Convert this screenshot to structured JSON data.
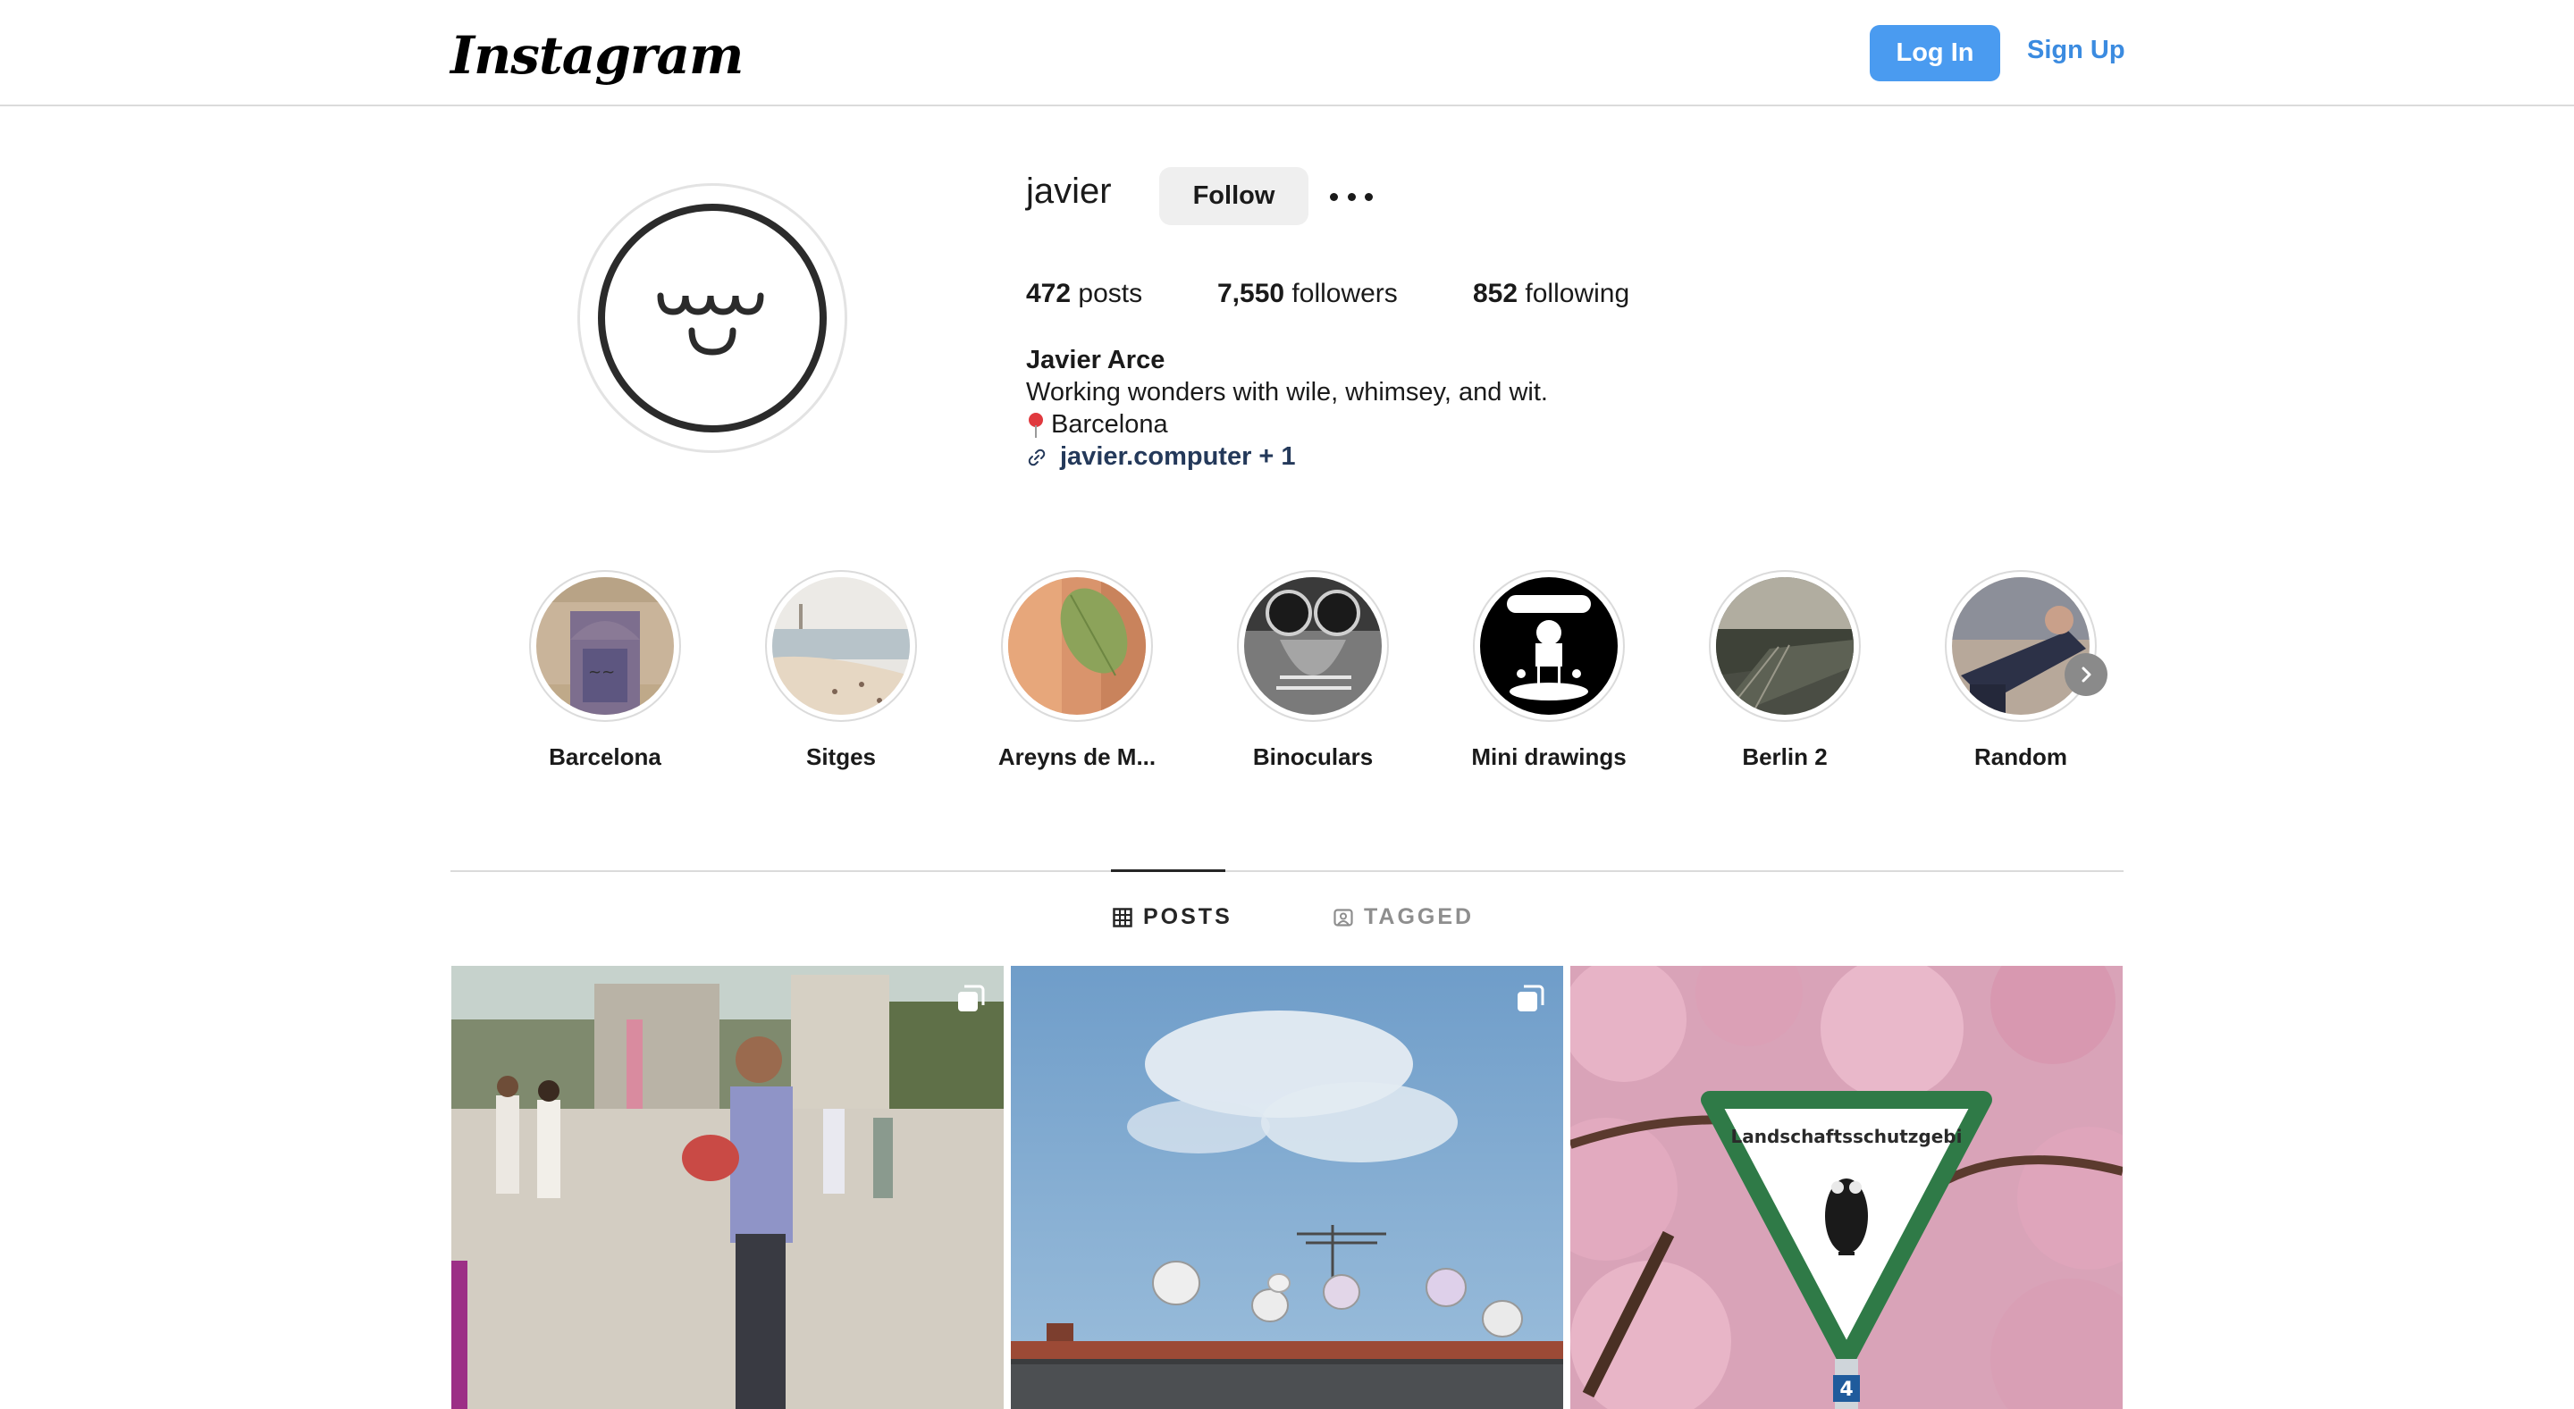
{
  "nav": {
    "logo_text": "Instagram",
    "login_label": "Log In",
    "signup_label": "Sign Up",
    "accent_color": "#4a9bf0"
  },
  "profile": {
    "username": "javier",
    "follow_label": "Follow",
    "avatar_icon": "smiley-face-icon",
    "stats": [
      {
        "count": "472",
        "label": "posts"
      },
      {
        "count": "7,550",
        "label": "followers"
      },
      {
        "count": "852",
        "label": "following"
      }
    ],
    "bio": {
      "name": "Javier Arce",
      "tagline": "Working wonders with wile, whimsey, and wit.",
      "location": "Barcelona",
      "link": "javier.computer + 1"
    }
  },
  "highlights": [
    {
      "label": "Barcelona"
    },
    {
      "label": "Sitges"
    },
    {
      "label": "Areyns de M..."
    },
    {
      "label": "Binoculars"
    },
    {
      "label": "Mini drawings"
    },
    {
      "label": "Berlin 2"
    },
    {
      "label": "Random"
    }
  ],
  "tabs": [
    {
      "label": "POSTS",
      "active": true
    },
    {
      "label": "TAGGED",
      "active": false
    }
  ],
  "posts": [
    {
      "multi": true
    },
    {
      "multi": true
    },
    {
      "multi": false,
      "sign_text": "Landschaftsschutzgebi",
      "sign_number": "4"
    }
  ]
}
